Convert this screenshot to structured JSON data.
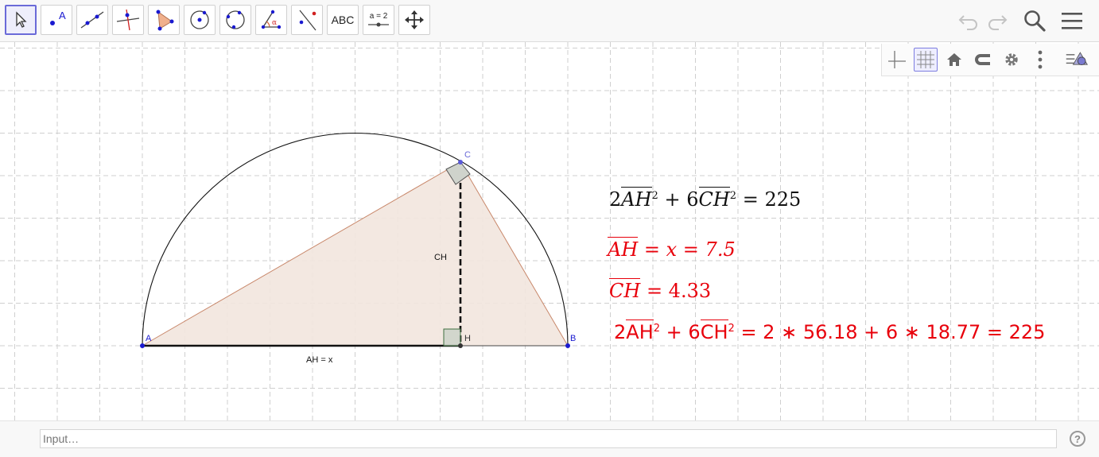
{
  "toolbar": {
    "tools": [
      {
        "name": "Move",
        "icon": "arrow-cursor-icon"
      },
      {
        "name": "Point",
        "icon": "point-icon",
        "label": "A"
      },
      {
        "name": "Line",
        "icon": "line-icon"
      },
      {
        "name": "Perpendicular Line",
        "icon": "perpendicular-line-icon"
      },
      {
        "name": "Polygon",
        "icon": "polygon-icon"
      },
      {
        "name": "Circle with Center",
        "icon": "circle-center-icon"
      },
      {
        "name": "Circle through 3 Points",
        "icon": "circle-three-points-icon"
      },
      {
        "name": "Angle",
        "icon": "angle-icon",
        "label": "α"
      },
      {
        "name": "Reflect about Line",
        "icon": "reflect-icon"
      },
      {
        "name": "Text",
        "icon": "text-tool-icon",
        "label": "ABC"
      },
      {
        "name": "Slider",
        "icon": "slider-icon",
        "label": "a = 2"
      },
      {
        "name": "Move Graphics View",
        "icon": "move-graphics-icon"
      }
    ],
    "right": [
      "undo-icon",
      "redo-icon",
      "search-icon",
      "menu-icon"
    ]
  },
  "style_bar": [
    "axes-icon",
    "grid-icon",
    "home-icon",
    "magnet-icon",
    "settings-icon",
    "more-icon",
    "toggle-style-bar-icon"
  ],
  "geometry": {
    "points": {
      "A": "A",
      "B": "B",
      "C": "C",
      "H": "H"
    },
    "segment_labels": {
      "AH": "AH = x",
      "CH": "CH"
    }
  },
  "formulas": {
    "f1": {
      "c1": "2",
      "s1": "AH",
      "e1": "2",
      "op": "+",
      "c2": "6",
      "s2": "CH",
      "e2": "2",
      "eq": "=",
      "rhs": "225"
    },
    "f2": {
      "s": "AH",
      "mid": "= x = 7.5"
    },
    "f3": {
      "s": "CH",
      "mid": "= 4.33"
    },
    "f4": {
      "c1": "2",
      "s1": "AH",
      "e1": "2",
      "op": "+",
      "c2": "6",
      "s2": "CH",
      "e2": "2",
      "rhs": "= 2 ∗ 56.18 + 6 ∗ 18.77 = 225"
    }
  },
  "colors": {
    "accent": "#6a6ad8",
    "formula_black": "#111111",
    "formula_red": "#e8000b",
    "triangle_fill": "#f2e6de",
    "triangle_stroke": "#c8876a",
    "point": "#1a1ad0"
  },
  "input": {
    "placeholder": "Input…",
    "value": ""
  },
  "help": "?"
}
